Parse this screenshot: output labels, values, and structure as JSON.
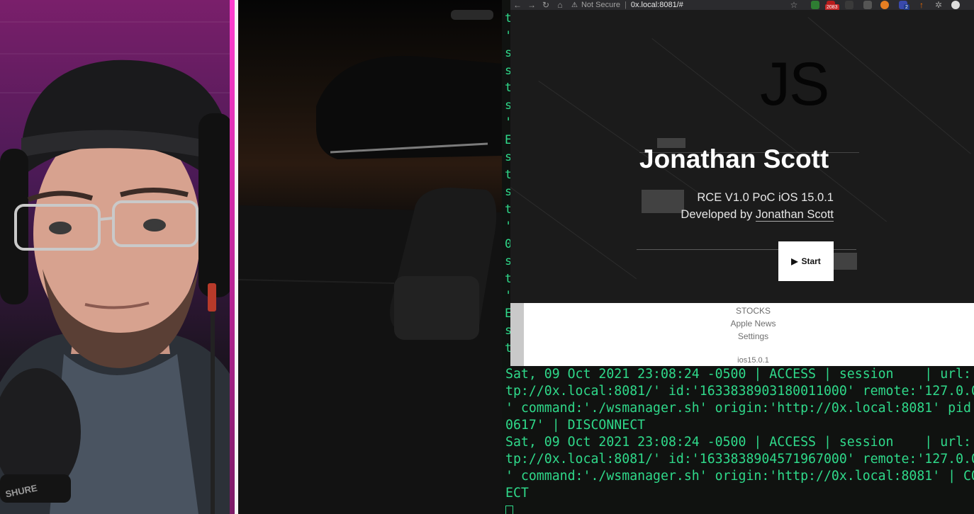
{
  "browser": {
    "security_label": "Not Secure",
    "url": "0x.local:8081/#",
    "extension_badge_count": "2083",
    "extension_badge_small": "2"
  },
  "page": {
    "logo_text": "JS",
    "title": "Jonathan Scott",
    "subtitle": "RCE V1.0 PoC iOS 15.0.1",
    "credit_prefix": "Developed by ",
    "credit_name": "Jonathan Scott",
    "start_label": "Start"
  },
  "menu": {
    "items": [
      "STOCKS",
      "Apple News",
      "Settings"
    ],
    "footer": "ios15.0.1"
  },
  "terminal": {
    "gutter_chars": [
      "t",
      "'",
      "s",
      "s",
      "t",
      "s",
      "'",
      "E",
      "s",
      "t",
      "s",
      "t",
      "'",
      "0",
      "s",
      "t",
      "'",
      "E",
      "s",
      "t"
    ],
    "lines": [
      "Sat, 09 Oct 2021 23:08:24 -0500 | ACCESS | session    | url:'",
      "tp://0x.local:8081/' id:'1633838903180011000' remote:'127.0.0",
      "' command:'./wsmanager.sh' origin:'http://0x.local:8081' pid:",
      "0617' | DISCONNECT",
      "Sat, 09 Oct 2021 23:08:24 -0500 | ACCESS | session    | url:'",
      "tp://0x.local:8081/' id:'1633838904571967000' remote:'127.0.0",
      "' command:'./wsmanager.sh' origin:'http://0x.local:8081' | CO",
      "ECT"
    ]
  },
  "colors": {
    "terminal_text": "#2fd98a",
    "page_bg": "#1b1b1b",
    "webcam_accent": "#ff3fd0"
  }
}
